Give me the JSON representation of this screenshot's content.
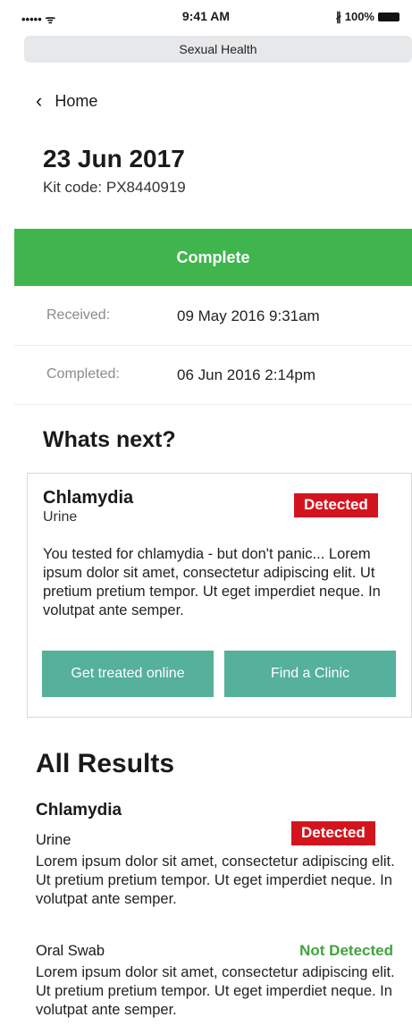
{
  "status_bar": {
    "signal": "••••• ᯤ",
    "time": "9:41 AM",
    "battery_text": "∦ 100%"
  },
  "browser": {
    "title": "Sexual Health"
  },
  "nav": {
    "back_label": "Home"
  },
  "header": {
    "date": "23 Jun 2017",
    "kit_code": "Kit code: PX8440919"
  },
  "status": {
    "label": "Complete",
    "color": "#40b54e"
  },
  "timeline": [
    {
      "label": "Received:",
      "value": "09 May 2016  9:31am"
    },
    {
      "label": "Completed:",
      "value": "06 Jun 2016  2:14pm"
    }
  ],
  "whats_next": {
    "heading": "Whats next?",
    "card": {
      "test": "Chlamydia",
      "sample": "Urine",
      "result": "Detected",
      "text": "You tested for chlamydia - but don't panic... Lorem ipsum dolor sit amet, consectetur adipiscing elit. Ut pretium pretium tempor. Ut eget imperdiet neque. In volutpat ante semper.",
      "buttons": [
        "Get treated online",
        "Find a Clinic"
      ]
    }
  },
  "all_results": {
    "heading": "All Results",
    "test": "Chlamydia",
    "items": [
      {
        "sample": "Urine",
        "result": "Detected",
        "text": "Lorem ipsum dolor sit amet, consectetur adipiscing elit. Ut pretium pretium tempor. Ut eget imperdiet neque. In volutpat ante semper."
      },
      {
        "sample": "Oral Swab",
        "result": "Not Detected",
        "text": "Lorem ipsum dolor sit amet, consectetur adipiscing elit. Ut pretium pretium tempor. Ut eget imperdiet neque. In volutpat ante semper."
      }
    ]
  },
  "colors": {
    "detected": "#d3141e",
    "not_detected": "#41a33d",
    "button": "#55b09c"
  }
}
